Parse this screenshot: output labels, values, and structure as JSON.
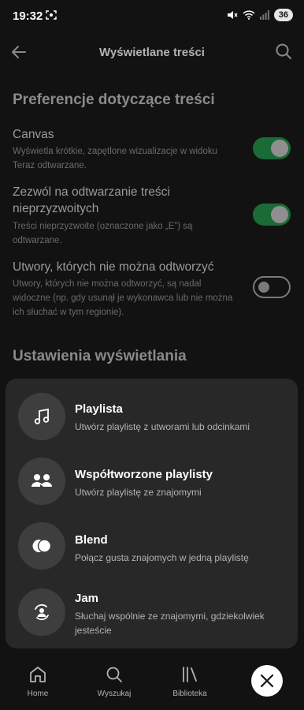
{
  "status_bar": {
    "time": "19:32",
    "battery": "36"
  },
  "header": {
    "title": "Wyświetlane treści"
  },
  "content_prefs": {
    "section_title": "Preferencje dotyczące treści",
    "items": [
      {
        "title": "Canvas",
        "description": "Wyświetla krótkie, zapętlone wizualizacje w widoku Teraz odtwarzane.",
        "enabled": true
      },
      {
        "title": "Zezwól na odtwarzanie treści nieprzyzwoitych",
        "description": "Treści nieprzyzwoite (oznaczone jako „E”) są odtwarzane.",
        "enabled": true
      },
      {
        "title": "Utwory, których nie można odtworzyć",
        "description": "Utwory, których nie można odtworzyć, są nadal widoczne (np. gdy usunął je wykonawca lub nie można ich słuchać w tym regionie).",
        "enabled": false
      }
    ]
  },
  "display_settings": {
    "section_title": "Ustawienia wyświetlania"
  },
  "sheet": {
    "options": [
      {
        "title": "Playlista",
        "description": "Utwórz playlistę z utworami lub odcinkami",
        "icon": "music-note-icon"
      },
      {
        "title": "Współtworzone playlisty",
        "description": "Utwórz playlistę ze znajomymi",
        "icon": "collaborators-icon"
      },
      {
        "title": "Blend",
        "description": "Połącz gusta znajomych w jedną playlistę",
        "icon": "blend-icon"
      },
      {
        "title": "Jam",
        "description": "Słuchaj wspólnie ze znajomymi, gdziekolwiek jesteście",
        "icon": "jam-icon"
      }
    ]
  },
  "nav": {
    "home": "Home",
    "search": "Wyszukaj",
    "library": "Biblioteka"
  },
  "colors": {
    "accent_green": "#1a6b36",
    "sheet_bg": "#282828",
    "background": "#121212"
  }
}
